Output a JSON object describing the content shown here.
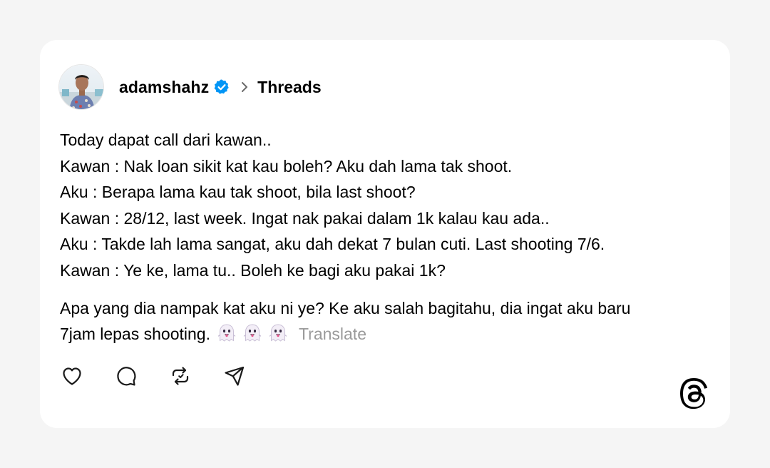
{
  "post": {
    "username": "adamshahz",
    "verified": true,
    "channel": "Threads",
    "paragraphs": [
      {
        "lines": [
          "Today dapat call dari kawan..",
          "Kawan : Nak loan sikit kat kau boleh? Aku dah lama tak shoot.",
          "Aku : Berapa lama kau tak shoot, bila last shoot?",
          "Kawan : 28/12, last week. Ingat nak pakai dalam 1k kalau kau ada..",
          "Aku : Takde lah lama sangat, aku dah dekat 7 bulan cuti. Last shooting 7/6.",
          "Kawan : Ye ke, lama tu.. Boleh ke bagi aku pakai 1k?"
        ]
      },
      {
        "lines": [
          "Apa yang dia nampak kat aku ni ye? Ke aku salah bagitahu, dia ingat aku baru",
          "7jam lepas shooting."
        ]
      }
    ],
    "emoji": [
      "ghost",
      "ghost",
      "ghost"
    ],
    "translate_label": "Translate"
  },
  "actions": [
    "heart-icon",
    "comment-icon",
    "repost-icon",
    "share-icon"
  ],
  "colors": {
    "background": "#f5f5f5",
    "card": "#ffffff",
    "verified_badge": "#0095f6",
    "translate_text": "#9a9a9a"
  }
}
